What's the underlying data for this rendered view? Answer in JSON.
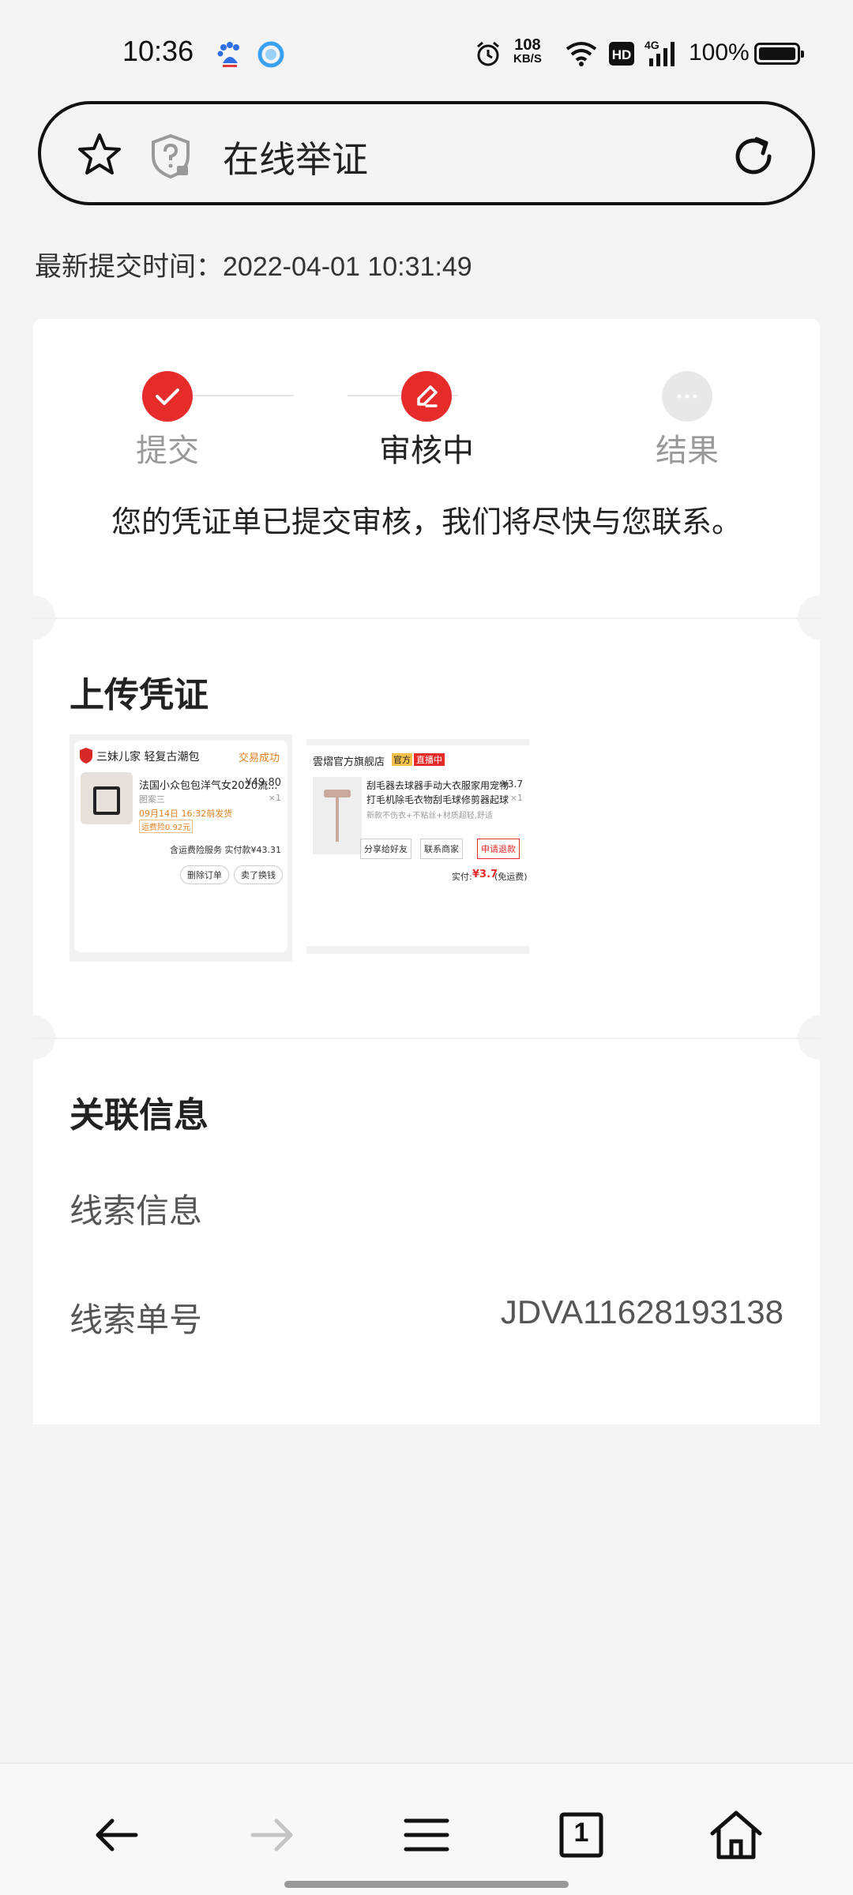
{
  "status_bar": {
    "time": "10:36",
    "net_speed_value": "108",
    "net_speed_unit": "KB/S",
    "battery_percent": "100%",
    "icons": [
      "baidu-icon",
      "browser-icon",
      "alarm-icon",
      "wifi-icon",
      "hd-icon",
      "signal-4g-icon",
      "battery-icon"
    ]
  },
  "url_bar": {
    "title": "在线举证",
    "icons": [
      "star-icon",
      "shield-question-icon",
      "refresh-icon"
    ]
  },
  "page": {
    "submit_time_label": "最新提交时间：",
    "submit_time_value": "2022-04-01 10:31:49",
    "steps": [
      {
        "label": "提交",
        "state": "done",
        "icon": "check-icon"
      },
      {
        "label": "审核中",
        "state": "current",
        "icon": "edit-icon"
      },
      {
        "label": "结果",
        "state": "pending",
        "icon": "dots-icon"
      }
    ],
    "status_message": "您的凭证单已提交审核，我们将尽快与您联系。",
    "upload_section_title": "上传凭证",
    "related_section_title": "关联信息",
    "clue_info_label": "线索信息",
    "clue_number_label": "线索单号",
    "clue_number_value": "JDVA11628193138",
    "accent_color": "#e62b2b"
  },
  "evidence_images": [
    {
      "shop": "三妹儿家 轻复古潮包",
      "status": "交易成功",
      "product": "法国小众包包洋气女2020流...",
      "price": "¥49.80",
      "variant": "图案三",
      "qty": "×1",
      "ship_note": "09月14日 16:32前发货",
      "tag": "运费险0.92元",
      "paid_label": "含运费险服务  实付款¥43.31",
      "buttons": [
        "删除订单",
        "卖了换钱"
      ]
    },
    {
      "shop": "雲熠官方旗舰店",
      "badge1": "官方",
      "badge2": "直播中",
      "product_line1": "刮毛器去球器手动大衣服家用宠物",
      "product_line2": "打毛机除毛衣物刮毛球修剪器起球",
      "product_line3": "新款不伤衣+不粘丝+材质超轻,舒适",
      "price": "¥3.7",
      "qty": "×1",
      "buttons": [
        "分享给好友",
        "联系商家",
        "申请退款"
      ],
      "paid_label": "实付:",
      "paid_value": "¥3.7",
      "paid_note": "(免运费)"
    }
  ],
  "bottom_nav": {
    "tab_count": "1",
    "icons": [
      "back-arrow-icon",
      "forward-arrow-icon",
      "menu-icon",
      "tabs-icon",
      "home-icon"
    ]
  }
}
